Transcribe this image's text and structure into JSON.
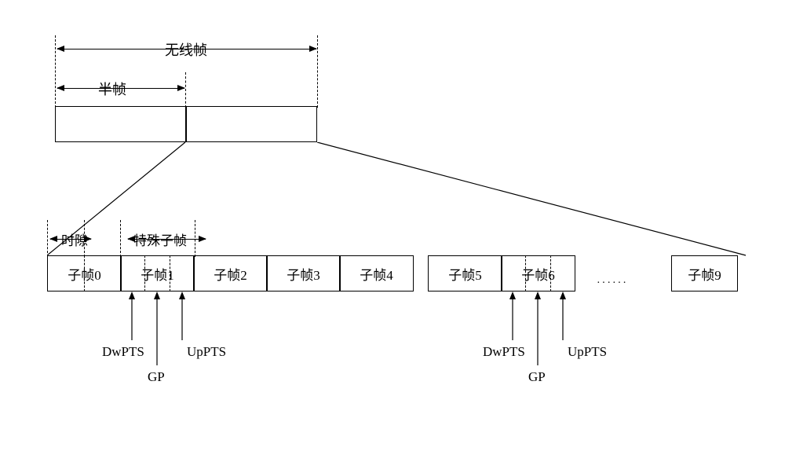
{
  "labels": {
    "radio_frame": "无线帧",
    "half_frame": "半帧",
    "slot": "时隙",
    "special_subframe": "特殊子帧",
    "dots": "······"
  },
  "subframes": {
    "sf0": "子帧0",
    "sf1": "子帧1",
    "sf2": "子帧2",
    "sf3": "子帧3",
    "sf4": "子帧4",
    "sf5": "子帧5",
    "sf6": "子帧6",
    "sf9": "子帧9"
  },
  "annotations": {
    "dwpts": "DwPTS",
    "gp": "GP",
    "uppts": "UpPTS"
  }
}
